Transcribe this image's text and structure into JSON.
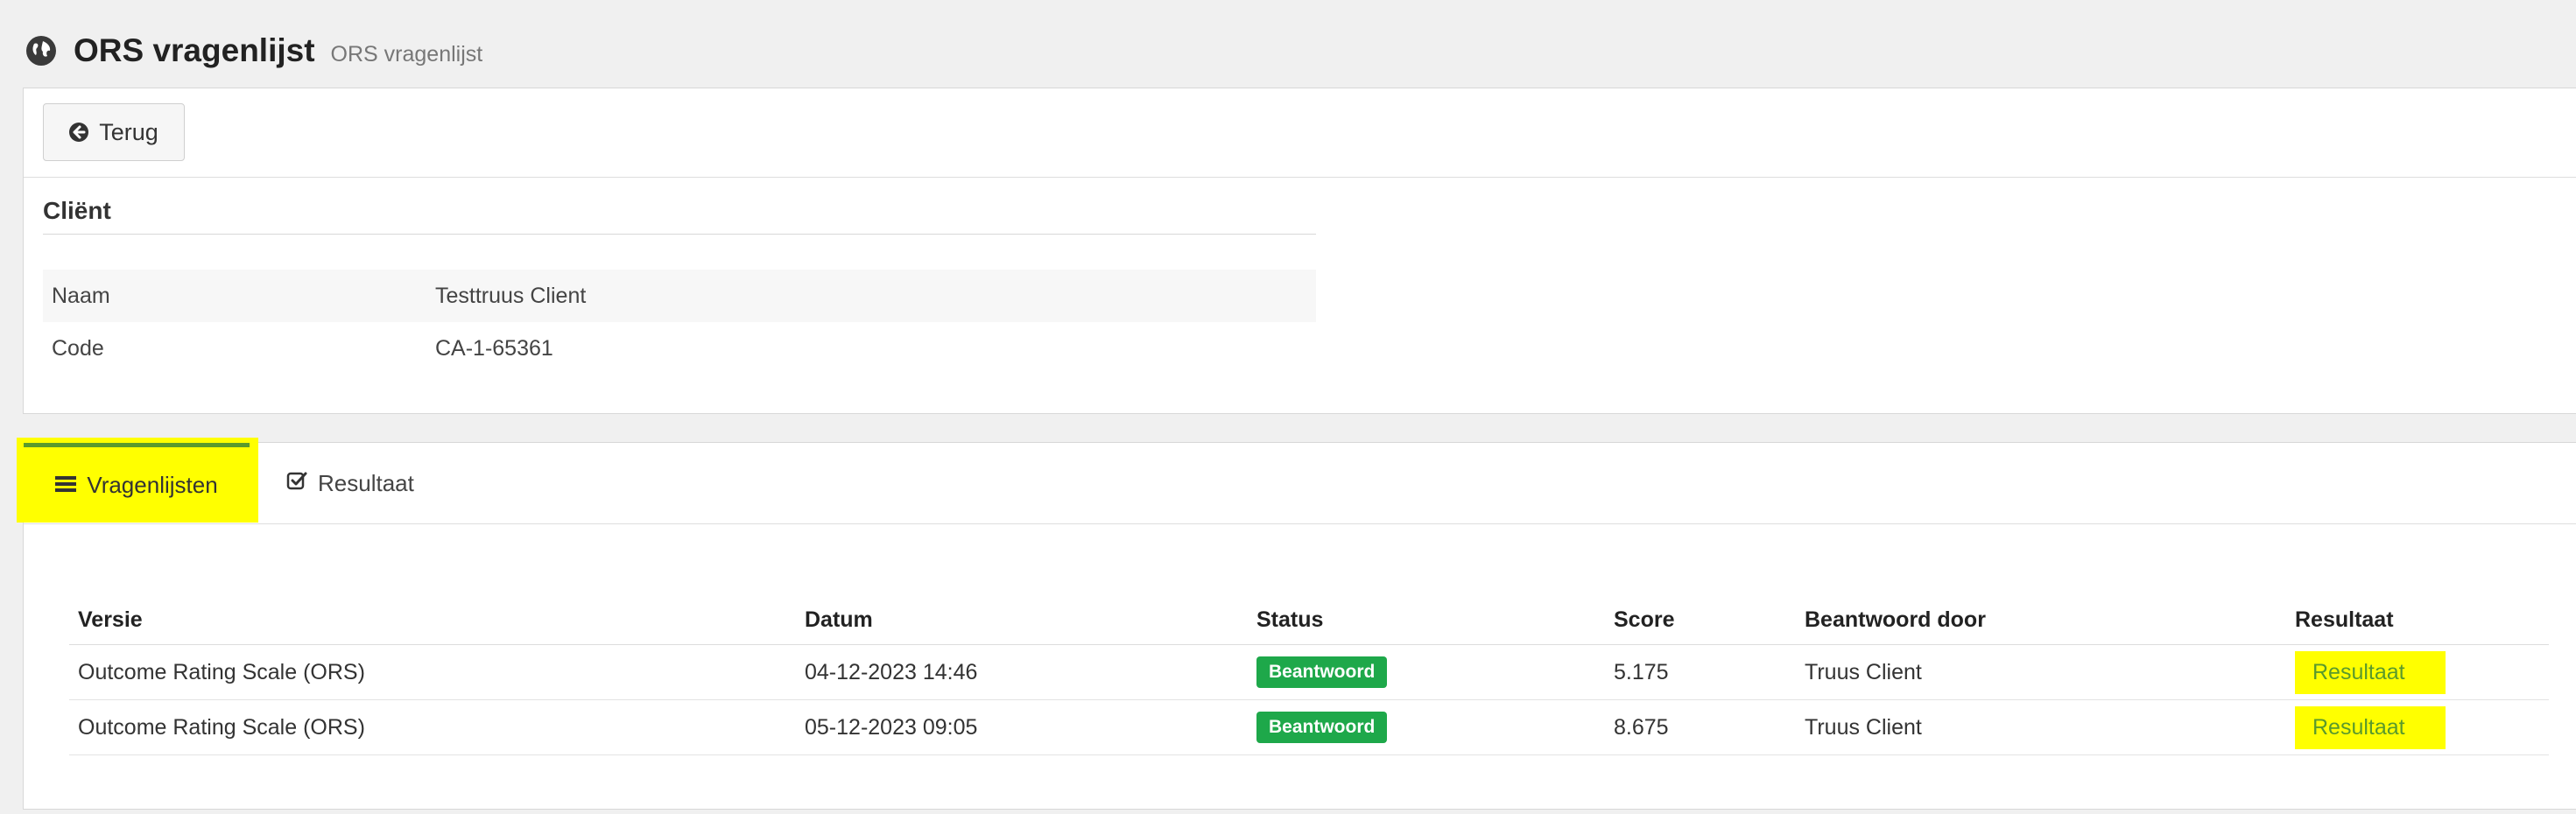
{
  "header": {
    "title": "ORS vragenlijst",
    "subtitle": "ORS vragenlijst",
    "icon": "globe-icon"
  },
  "toolbar": {
    "back_label": "Terug",
    "back_icon": "arrow-circle-left-icon"
  },
  "client": {
    "section_title": "Cliënt",
    "fields": [
      {
        "label": "Naam",
        "value": "Testtruus Client"
      },
      {
        "label": "Code",
        "value": "CA-1-65361"
      }
    ]
  },
  "tabs": [
    {
      "label": "Vragenlijsten",
      "icon": "bars-icon",
      "active": true
    },
    {
      "label": "Resultaat",
      "icon": "check-square-icon",
      "active": false
    }
  ],
  "table": {
    "columns": [
      "Versie",
      "Datum",
      "Status",
      "Score",
      "Beantwoord door",
      "Resultaat"
    ],
    "rows": [
      {
        "versie": "Outcome Rating Scale (ORS)",
        "datum": "04-12-2023 14:46",
        "status": "Beantwoord",
        "score": "5.175",
        "door": "Truus Client",
        "resultaat": "Resultaat"
      },
      {
        "versie": "Outcome Rating Scale (ORS)",
        "datum": "05-12-2023 09:05",
        "status": "Beantwoord",
        "score": "8.675",
        "door": "Truus Client",
        "resultaat": "Resultaat"
      }
    ]
  },
  "colors": {
    "accent_green": "#5a9a2c",
    "badge_green": "#1ea84a",
    "highlight": "#ffff00"
  }
}
